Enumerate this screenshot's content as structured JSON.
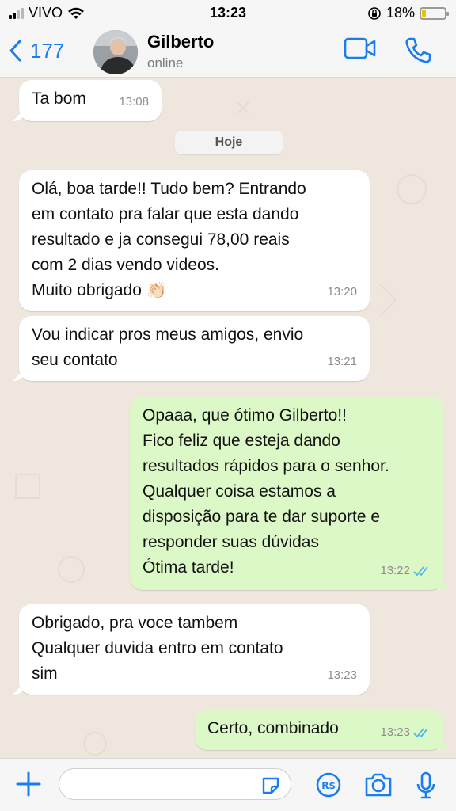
{
  "status_bar": {
    "carrier": "VIVO",
    "time": "13:23",
    "battery": "18%",
    "battery_level": 0.18
  },
  "header": {
    "back_count": "177",
    "contact_name": "Gilberto",
    "contact_status": "online",
    "icons": [
      "chevron-left-icon",
      "video-camera-icon",
      "phone-icon"
    ]
  },
  "chat": {
    "day_label": "Hoje",
    "messages": [
      {
        "direction": "in",
        "lines": [
          "Ta bom"
        ],
        "time": "13:08"
      },
      {
        "direction": "in",
        "lines": [
          "Olá, boa tarde!! Tudo bem? Entrando",
          "em contato pra falar que esta dando",
          "resultado e ja consegui 78,00 reais",
          "com 2 dias vendo videos.",
          "Muito obrigado 👏🏻"
        ],
        "time": "13:20"
      },
      {
        "direction": "in",
        "lines": [
          "Vou indicar pros meus amigos, envio",
          "seu contato"
        ],
        "time": "13:21"
      },
      {
        "direction": "out",
        "lines": [
          "Opaaa, que ótimo Gilberto!!",
          "Fico feliz que esteja dando",
          "resultados rápidos para o senhor.",
          "Qualquer coisa estamos a",
          "disposição para te dar suporte e",
          "responder suas dúvidas",
          "Ótima tarde!"
        ],
        "time": "13:22",
        "read": true
      },
      {
        "direction": "in",
        "lines": [
          "Obrigado, pra voce tambem",
          "Qualquer duvida entro em contato",
          "sim"
        ],
        "time": "13:23"
      },
      {
        "direction": "out",
        "lines": [
          "Certo, combinado"
        ],
        "time": "13:23",
        "read": true
      }
    ]
  },
  "input_bar": {
    "placeholder": "",
    "icons": [
      "plus-icon",
      "sticker-icon",
      "payment-icon",
      "camera-icon",
      "microphone-icon"
    ]
  },
  "colors": {
    "accent": "#1a7cf2",
    "outgoing_bubble": "#dcf8c6",
    "incoming_bubble": "#ffffff",
    "read_ticks": "#4fb6ec",
    "chat_background": "#efe7de"
  }
}
